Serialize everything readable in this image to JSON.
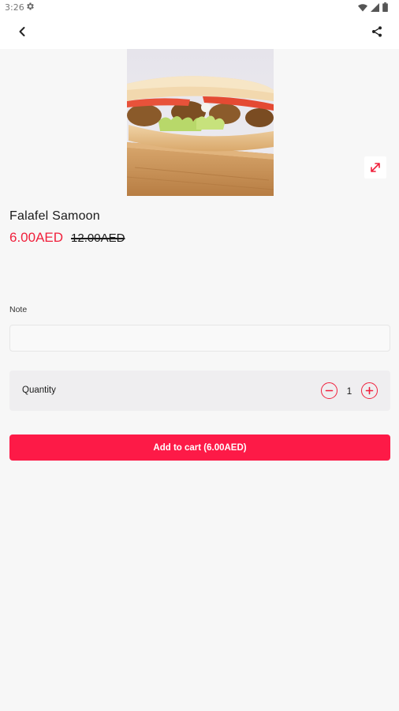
{
  "status_bar": {
    "time": "3:26",
    "icons": [
      "gear-icon",
      "wifi-icon",
      "signal-icon",
      "battery-icon"
    ]
  },
  "app_bar": {
    "back_icon": "chevron-left-icon",
    "share_icon": "share-icon"
  },
  "product": {
    "image_alt": "falafel-sandwich-photo",
    "expand_icon": "expand-icon",
    "name": "Falafel Samoon",
    "price": "6.00AED",
    "old_price": "12.00AED"
  },
  "note": {
    "label": "Note",
    "value": "",
    "placeholder": ""
  },
  "quantity": {
    "label": "Quantity",
    "value": "1",
    "decrement_icon": "minus-circle-icon",
    "increment_icon": "plus-circle-icon"
  },
  "cart_button": {
    "label": "Add to cart (6.00AED)"
  },
  "colors": {
    "accent": "#f0203c",
    "button": "#fd1a47",
    "background": "#f7f7f7",
    "card": "#efeef0"
  }
}
